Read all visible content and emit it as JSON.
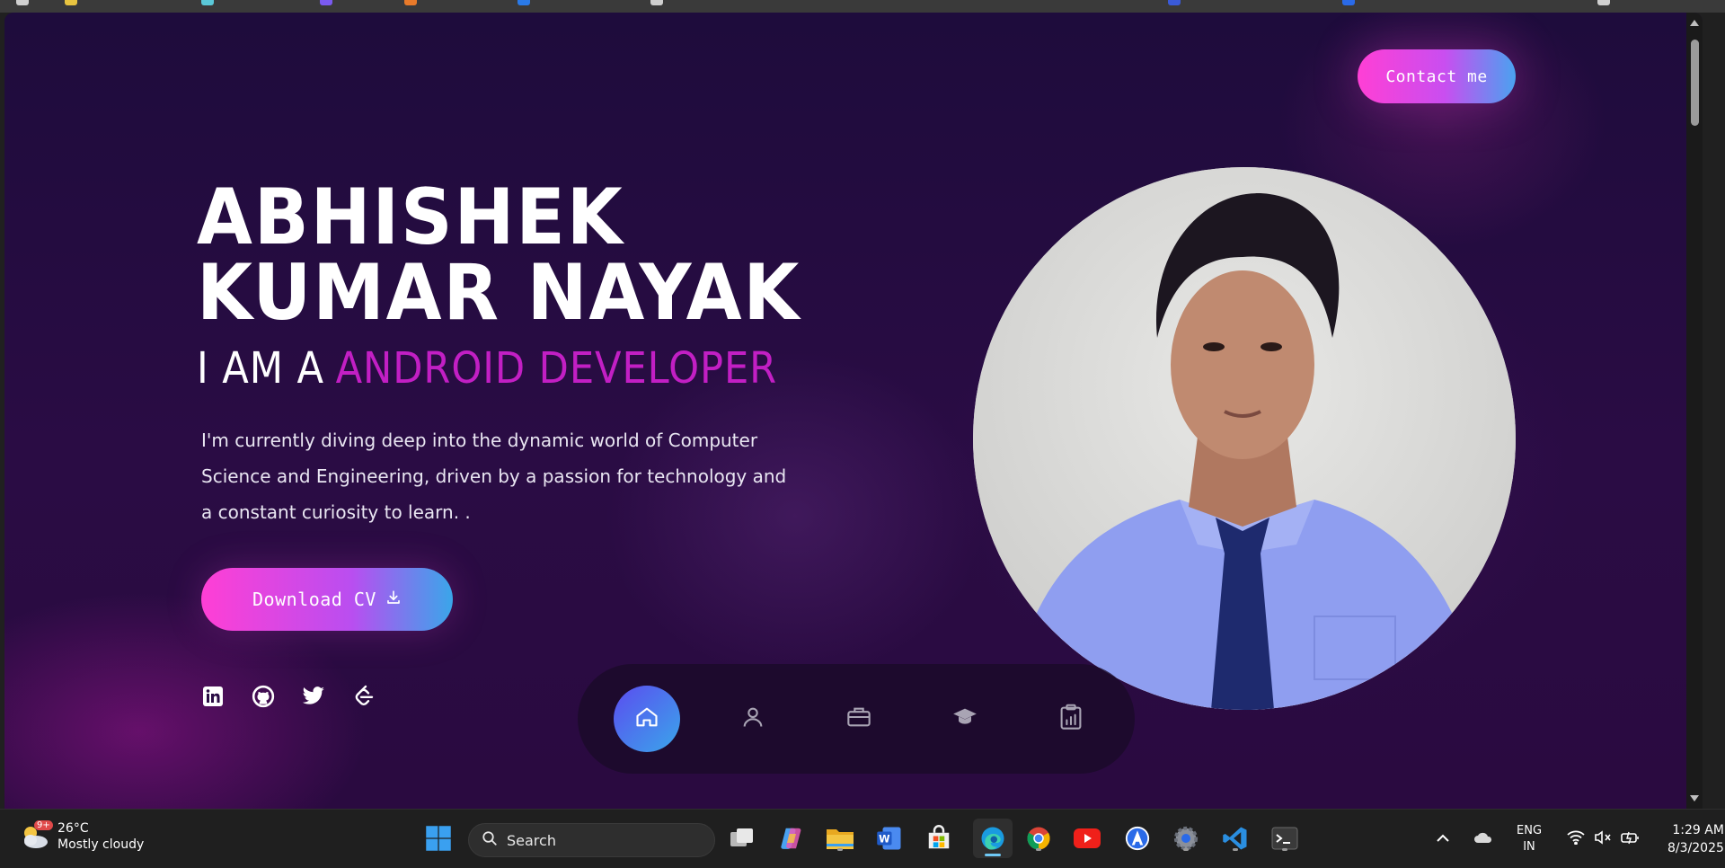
{
  "page": {
    "contact_label": "Contact me",
    "name": "ABHISHEK KUMAR NAYAK",
    "role_prefix": "I AM A",
    "role": "ANDROID DEVELOPER",
    "description": "I'm currently diving deep into the dynamic world of Computer Science and Engineering, driven by a passion for technology and a constant curiosity to learn. .",
    "download_label": "Download CV",
    "socials": [
      "linkedin-icon",
      "github-icon",
      "twitter-icon",
      "leetcode-icon"
    ],
    "dock_items": [
      "home-icon",
      "user-icon",
      "briefcase-icon",
      "graduation-cap-icon",
      "clipboard-chart-icon"
    ],
    "dock_active": "home-icon",
    "colors": {
      "accent": "#c21fc4",
      "button_start": "#ff3fd5",
      "button_end": "#3aa6ea",
      "bg": "#1e0c3c"
    }
  },
  "taskbar": {
    "weather_temp": "26°C",
    "weather_desc": "Mostly cloudy",
    "weather_badge": "9+",
    "search_label": "Search",
    "lang_line1": "ENG",
    "lang_line2": "IN",
    "time": "1:29 AM",
    "date": "8/3/2025",
    "apps": [
      "windows-start-icon",
      "task-view-icon",
      "copilot-icon",
      "file-explorer-icon",
      "word-icon",
      "store-icon",
      "edge-icon",
      "chrome-icon",
      "youtube-icon",
      "app-icon",
      "settings-icon",
      "vscode-icon",
      "terminal-icon"
    ]
  }
}
